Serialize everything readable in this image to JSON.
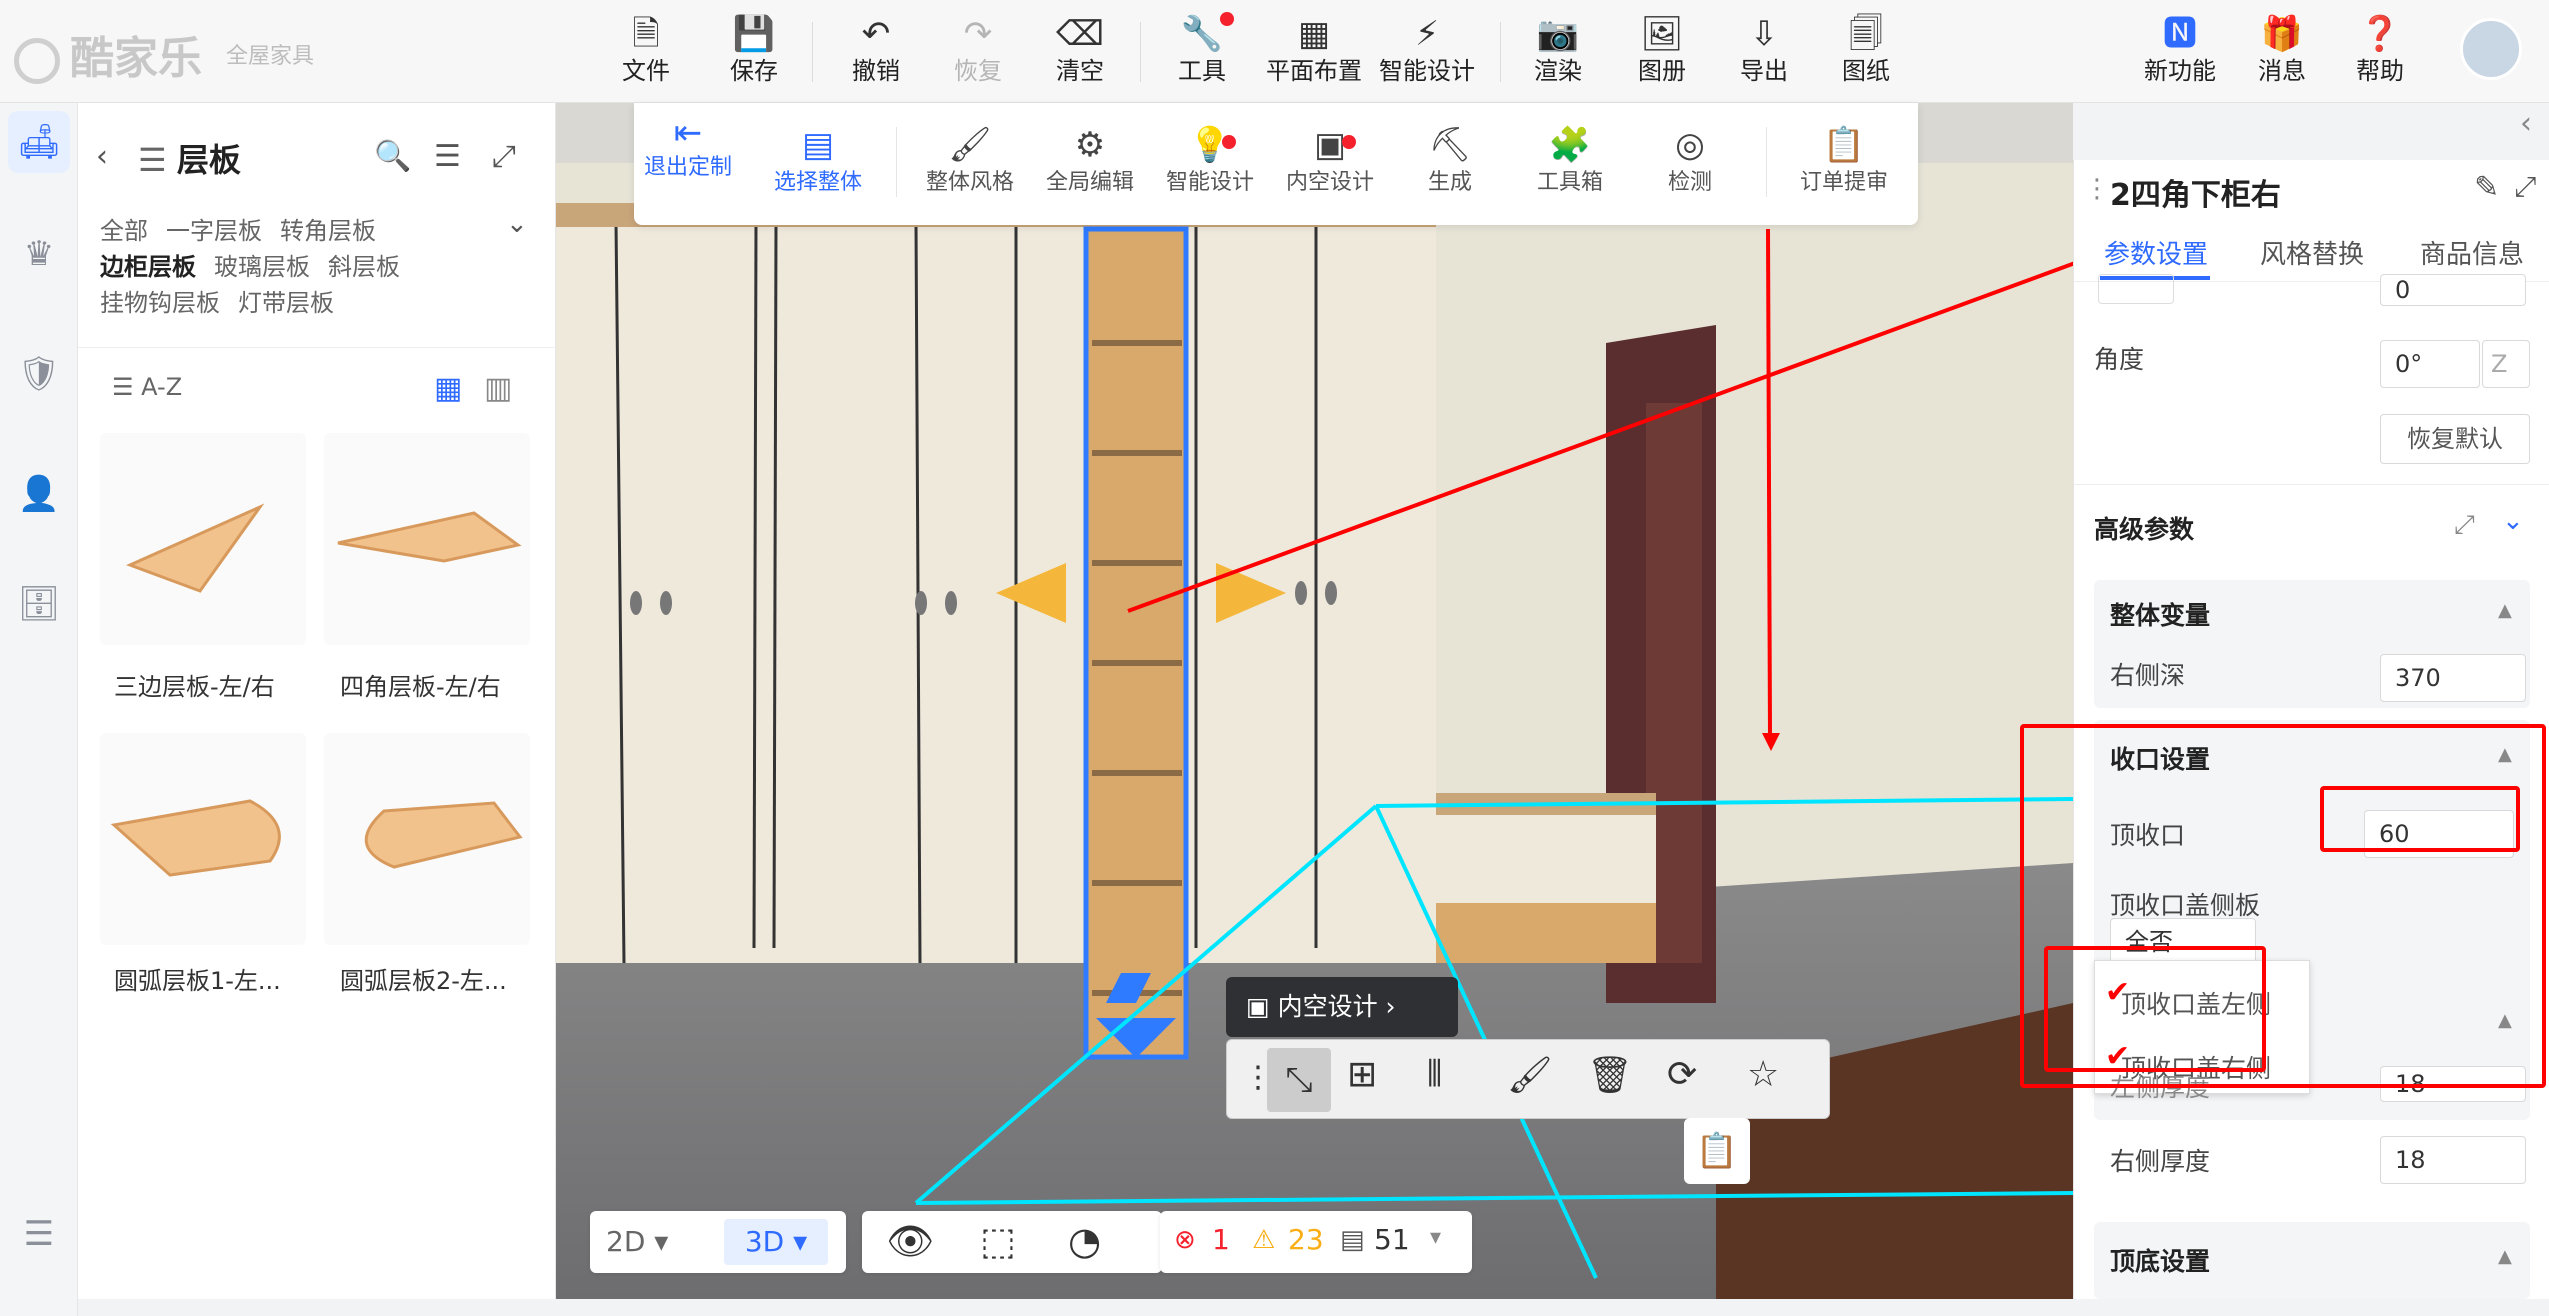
{
  "brand": {
    "name": "酷家乐",
    "sub": "全屋家具"
  },
  "topbar": [
    {
      "label": "文件",
      "icon": "file-icon"
    },
    {
      "label": "保存",
      "icon": "save-icon"
    },
    {
      "label": "撤销",
      "icon": "undo-icon"
    },
    {
      "label": "恢复",
      "icon": "redo-icon"
    },
    {
      "label": "清空",
      "icon": "eraser-icon"
    },
    {
      "label": "工具",
      "icon": "wrench-icon"
    },
    {
      "label": "平面布置",
      "icon": "floorplan-icon"
    },
    {
      "label": "智能设计",
      "icon": "lightning-icon"
    },
    {
      "label": "渲染",
      "icon": "camera-icon"
    },
    {
      "label": "图册",
      "icon": "image-icon"
    },
    {
      "label": "导出",
      "icon": "export-icon"
    },
    {
      "label": "图纸",
      "icon": "drawing-icon"
    }
  ],
  "topright": [
    {
      "label": "新功能",
      "icon": "new-icon"
    },
    {
      "label": "消息",
      "icon": "gift-icon"
    },
    {
      "label": "帮助",
      "icon": "help-icon"
    }
  ],
  "panel": {
    "title": "层板",
    "categories": [
      "全部",
      "一字层板",
      "转角层板",
      "边柜层板",
      "玻璃层板",
      "斜层板",
      "挂物钩层板",
      "灯带层板"
    ],
    "selected_category": "边柜层板",
    "sort_label": "A-Z",
    "items": [
      "三边层板-左/右",
      "四角层板-左/右",
      "圆弧层板1-左...",
      "圆弧层板2-左..."
    ]
  },
  "ribbon": [
    {
      "label": "退出定制",
      "icon": "exit-icon"
    },
    {
      "label": "选择整体",
      "icon": "select-icon"
    },
    {
      "label": "整体风格",
      "icon": "paint-roller-icon"
    },
    {
      "label": "全局编辑",
      "icon": "global-edit-icon"
    },
    {
      "label": "智能设计",
      "icon": "smart-design-icon"
    },
    {
      "label": "内空设计",
      "icon": "inner-design-icon"
    },
    {
      "label": "生成",
      "icon": "generate-icon"
    },
    {
      "label": "工具箱",
      "icon": "puzzle-icon"
    },
    {
      "label": "检测",
      "icon": "detect-icon"
    },
    {
      "label": "订单提审",
      "icon": "order-icon"
    }
  ],
  "scene": {
    "inner_design_label": "内空设计"
  },
  "bottom": {
    "view_2d": "2D",
    "view_3d": "3D",
    "errors": "1",
    "warnings": "23",
    "items": "51"
  },
  "rpanel": {
    "title": "2四角下柜右",
    "tabs": [
      "参数设置",
      "风格替换",
      "商品信息"
    ],
    "partial_value": "0",
    "angle_label": "角度",
    "angle_value": "0°",
    "axis_value": "Z",
    "reset_label": "恢复默认",
    "advanced_label": "高级参数",
    "overall_label": "整体变量",
    "right_depth_label": "右侧深",
    "right_depth_value": "370",
    "closure_label": "收口设置",
    "top_closure_label": "顶收口",
    "top_closure_value": "60",
    "top_cover_label": "顶收口盖侧板",
    "top_cover_value": "全否",
    "option_left": "顶收口盖左侧",
    "option_right": "顶收口盖右侧",
    "left_thick_label": "左侧厚度",
    "left_thick_value": "18",
    "right_thick_label": "右侧厚度",
    "right_thick_value": "18",
    "topbottom_label": "顶底设置"
  },
  "colors": {
    "accent": "#2f6bff",
    "annotation": "#ff0000",
    "selection": "#00e5ff"
  }
}
